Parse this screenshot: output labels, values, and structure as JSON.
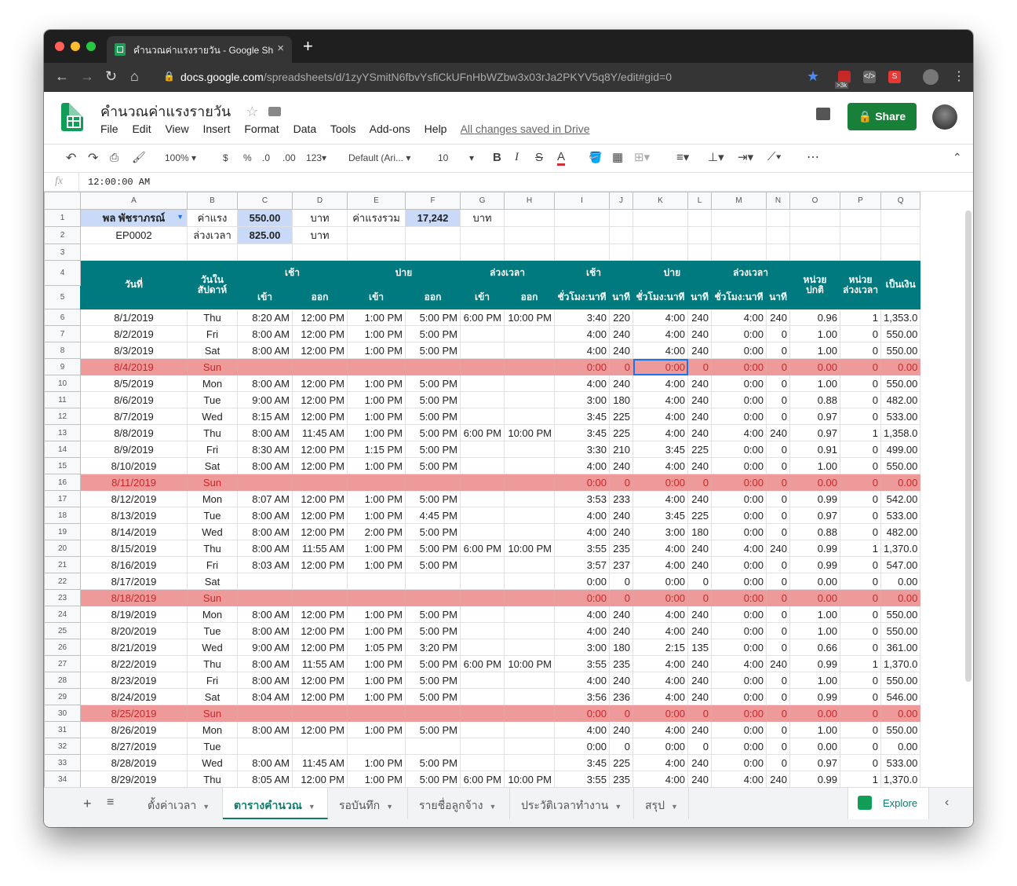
{
  "browser": {
    "tab_title": "คำนวณค่าแรงรายวัน - Google Sh",
    "url_domain": "docs.google.com",
    "url_path": "/spreadsheets/d/1zyYSmitN6fbvYsfiCkUFnHbWZbw3x03rJa2PKYV5q8Y/edit#gid=0",
    "ext_badge": ">3k"
  },
  "doc": {
    "title": "คำนวณค่าแรงรายวัน",
    "menus": [
      "File",
      "Edit",
      "View",
      "Insert",
      "Format",
      "Data",
      "Tools",
      "Add-ons",
      "Help"
    ],
    "saved_status": "All changes saved in Drive",
    "share_label": "Share"
  },
  "toolbar": {
    "zoom": "100%",
    "currency": "$",
    "percent": "%",
    "dec_less": ".0",
    "dec_more": ".00",
    "format_more": "123",
    "font": "Default (Ari...",
    "font_size": "10",
    "bold": "B",
    "italic": "I",
    "strike": "S",
    "text_color": "A",
    "more": "⋯"
  },
  "formula_bar": {
    "fx": "fx",
    "value": "12:00:00 AM"
  },
  "columns": [
    "A",
    "B",
    "C",
    "D",
    "E",
    "F",
    "G",
    "H",
    "I",
    "J",
    "K",
    "L",
    "M",
    "N",
    "O",
    "P",
    "Q"
  ],
  "top_rows": [
    [
      "พล พัชราภรณ์",
      "ค่าแรง",
      "550.00",
      "บาท",
      "ค่าแรงรวม",
      "17,242",
      "บาท",
      "",
      "",
      "",
      "",
      "",
      "",
      "",
      "",
      "",
      ""
    ],
    [
      "EP0002",
      "ล่วงเวลา",
      "825.00",
      "บาท",
      "",
      "",
      "",
      "",
      "",
      "",
      "",
      "",
      "",
      "",
      "",
      "",
      ""
    ],
    [
      "",
      "",
      "",
      "",
      "",
      "",
      "",
      "",
      "",
      "",
      "",
      "",
      "",
      "",
      "",
      "",
      ""
    ]
  ],
  "header": {
    "date": "วันที่",
    "weekday": "วันใน\nสัปดาห์",
    "morning": "เช้า",
    "afternoon": "บ่าย",
    "overtime": "ล่วงเวลา",
    "in": "เข้า",
    "out": "ออก",
    "hm": "ชั่วโมง:นาที",
    "min": "นาที",
    "units_normal": "หน่วย\nปกติ",
    "units_ot": "หน่วย\nล่วงเวลา",
    "amount": "เป็นเงิน"
  },
  "rows": [
    {
      "n": "6",
      "sun": false,
      "v": [
        "8/1/2019",
        "Thu",
        "8:20 AM",
        "12:00 PM",
        "1:00 PM",
        "5:00 PM",
        "6:00 PM",
        "10:00 PM",
        "3:40",
        "220",
        "4:00",
        "240",
        "4:00",
        "240",
        "0.96",
        "1",
        "1,353.0"
      ]
    },
    {
      "n": "7",
      "sun": false,
      "v": [
        "8/2/2019",
        "Fri",
        "8:00 AM",
        "12:00 PM",
        "1:00 PM",
        "5:00 PM",
        "",
        "",
        "4:00",
        "240",
        "4:00",
        "240",
        "0:00",
        "0",
        "1.00",
        "0",
        "550.00"
      ]
    },
    {
      "n": "8",
      "sun": false,
      "v": [
        "8/3/2019",
        "Sat",
        "8:00 AM",
        "12:00 PM",
        "1:00 PM",
        "5:00 PM",
        "",
        "",
        "4:00",
        "240",
        "4:00",
        "240",
        "0:00",
        "0",
        "1.00",
        "0",
        "550.00"
      ]
    },
    {
      "n": "9",
      "sun": true,
      "v": [
        "8/4/2019",
        "Sun",
        "",
        "",
        "",
        "",
        "",
        "",
        "0:00",
        "0",
        "0:00",
        "0",
        "0:00",
        "0",
        "0.00",
        "0",
        "0.00"
      ]
    },
    {
      "n": "10",
      "sun": false,
      "v": [
        "8/5/2019",
        "Mon",
        "8:00 AM",
        "12:00 PM",
        "1:00 PM",
        "5:00 PM",
        "",
        "",
        "4:00",
        "240",
        "4:00",
        "240",
        "0:00",
        "0",
        "1.00",
        "0",
        "550.00"
      ]
    },
    {
      "n": "11",
      "sun": false,
      "v": [
        "8/6/2019",
        "Tue",
        "9:00 AM",
        "12:00 PM",
        "1:00 PM",
        "5:00 PM",
        "",
        "",
        "3:00",
        "180",
        "4:00",
        "240",
        "0:00",
        "0",
        "0.88",
        "0",
        "482.00"
      ]
    },
    {
      "n": "12",
      "sun": false,
      "v": [
        "8/7/2019",
        "Wed",
        "8:15 AM",
        "12:00 PM",
        "1:00 PM",
        "5:00 PM",
        "",
        "",
        "3:45",
        "225",
        "4:00",
        "240",
        "0:00",
        "0",
        "0.97",
        "0",
        "533.00"
      ]
    },
    {
      "n": "13",
      "sun": false,
      "v": [
        "8/8/2019",
        "Thu",
        "8:00 AM",
        "11:45 AM",
        "1:00 PM",
        "5:00 PM",
        "6:00 PM",
        "10:00 PM",
        "3:45",
        "225",
        "4:00",
        "240",
        "4:00",
        "240",
        "0.97",
        "1",
        "1,358.0"
      ]
    },
    {
      "n": "14",
      "sun": false,
      "v": [
        "8/9/2019",
        "Fri",
        "8:30 AM",
        "12:00 PM",
        "1:15 PM",
        "5:00 PM",
        "",
        "",
        "3:30",
        "210",
        "3:45",
        "225",
        "0:00",
        "0",
        "0.91",
        "0",
        "499.00"
      ]
    },
    {
      "n": "15",
      "sun": false,
      "v": [
        "8/10/2019",
        "Sat",
        "8:00 AM",
        "12:00 PM",
        "1:00 PM",
        "5:00 PM",
        "",
        "",
        "4:00",
        "240",
        "4:00",
        "240",
        "0:00",
        "0",
        "1.00",
        "0",
        "550.00"
      ]
    },
    {
      "n": "16",
      "sun": true,
      "v": [
        "8/11/2019",
        "Sun",
        "",
        "",
        "",
        "",
        "",
        "",
        "0:00",
        "0",
        "0:00",
        "0",
        "0:00",
        "0",
        "0.00",
        "0",
        "0.00"
      ]
    },
    {
      "n": "17",
      "sun": false,
      "v": [
        "8/12/2019",
        "Mon",
        "8:07 AM",
        "12:00 PM",
        "1:00 PM",
        "5:00 PM",
        "",
        "",
        "3:53",
        "233",
        "4:00",
        "240",
        "0:00",
        "0",
        "0.99",
        "0",
        "542.00"
      ]
    },
    {
      "n": "18",
      "sun": false,
      "v": [
        "8/13/2019",
        "Tue",
        "8:00 AM",
        "12:00 PM",
        "1:00 PM",
        "4:45 PM",
        "",
        "",
        "4:00",
        "240",
        "3:45",
        "225",
        "0:00",
        "0",
        "0.97",
        "0",
        "533.00"
      ]
    },
    {
      "n": "19",
      "sun": false,
      "v": [
        "8/14/2019",
        "Wed",
        "8:00 AM",
        "12:00 PM",
        "2:00 PM",
        "5:00 PM",
        "",
        "",
        "4:00",
        "240",
        "3:00",
        "180",
        "0:00",
        "0",
        "0.88",
        "0",
        "482.00"
      ]
    },
    {
      "n": "20",
      "sun": false,
      "v": [
        "8/15/2019",
        "Thu",
        "8:00 AM",
        "11:55 AM",
        "1:00 PM",
        "5:00 PM",
        "6:00 PM",
        "10:00 PM",
        "3:55",
        "235",
        "4:00",
        "240",
        "4:00",
        "240",
        "0.99",
        "1",
        "1,370.0"
      ]
    },
    {
      "n": "21",
      "sun": false,
      "v": [
        "8/16/2019",
        "Fri",
        "8:03 AM",
        "12:00 PM",
        "1:00 PM",
        "5:00 PM",
        "",
        "",
        "3:57",
        "237",
        "4:00",
        "240",
        "0:00",
        "0",
        "0.99",
        "0",
        "547.00"
      ]
    },
    {
      "n": "22",
      "sun": false,
      "v": [
        "8/17/2019",
        "Sat",
        "",
        "",
        "",
        "",
        "",
        "",
        "0:00",
        "0",
        "0:00",
        "0",
        "0:00",
        "0",
        "0.00",
        "0",
        "0.00"
      ]
    },
    {
      "n": "23",
      "sun": true,
      "v": [
        "8/18/2019",
        "Sun",
        "",
        "",
        "",
        "",
        "",
        "",
        "0:00",
        "0",
        "0:00",
        "0",
        "0:00",
        "0",
        "0.00",
        "0",
        "0.00"
      ]
    },
    {
      "n": "24",
      "sun": false,
      "v": [
        "8/19/2019",
        "Mon",
        "8:00 AM",
        "12:00 PM",
        "1:00 PM",
        "5:00 PM",
        "",
        "",
        "4:00",
        "240",
        "4:00",
        "240",
        "0:00",
        "0",
        "1.00",
        "0",
        "550.00"
      ]
    },
    {
      "n": "25",
      "sun": false,
      "v": [
        "8/20/2019",
        "Tue",
        "8:00 AM",
        "12:00 PM",
        "1:00 PM",
        "5:00 PM",
        "",
        "",
        "4:00",
        "240",
        "4:00",
        "240",
        "0:00",
        "0",
        "1.00",
        "0",
        "550.00"
      ]
    },
    {
      "n": "26",
      "sun": false,
      "v": [
        "8/21/2019",
        "Wed",
        "9:00 AM",
        "12:00 PM",
        "1:05 PM",
        "3:20 PM",
        "",
        "",
        "3:00",
        "180",
        "2:15",
        "135",
        "0:00",
        "0",
        "0.66",
        "0",
        "361.00"
      ]
    },
    {
      "n": "27",
      "sun": false,
      "v": [
        "8/22/2019",
        "Thu",
        "8:00 AM",
        "11:55 AM",
        "1:00 PM",
        "5:00 PM",
        "6:00 PM",
        "10:00 PM",
        "3:55",
        "235",
        "4:00",
        "240",
        "4:00",
        "240",
        "0.99",
        "1",
        "1,370.0"
      ]
    },
    {
      "n": "28",
      "sun": false,
      "v": [
        "8/23/2019",
        "Fri",
        "8:00 AM",
        "12:00 PM",
        "1:00 PM",
        "5:00 PM",
        "",
        "",
        "4:00",
        "240",
        "4:00",
        "240",
        "0:00",
        "0",
        "1.00",
        "0",
        "550.00"
      ]
    },
    {
      "n": "29",
      "sun": false,
      "v": [
        "8/24/2019",
        "Sat",
        "8:04 AM",
        "12:00 PM",
        "1:00 PM",
        "5:00 PM",
        "",
        "",
        "3:56",
        "236",
        "4:00",
        "240",
        "0:00",
        "0",
        "0.99",
        "0",
        "546.00"
      ]
    },
    {
      "n": "30",
      "sun": true,
      "v": [
        "8/25/2019",
        "Sun",
        "",
        "",
        "",
        "",
        "",
        "",
        "0:00",
        "0",
        "0:00",
        "0",
        "0:00",
        "0",
        "0.00",
        "0",
        "0.00"
      ]
    },
    {
      "n": "31",
      "sun": false,
      "v": [
        "8/26/2019",
        "Mon",
        "8:00 AM",
        "12:00 PM",
        "1:00 PM",
        "5:00 PM",
        "",
        "",
        "4:00",
        "240",
        "4:00",
        "240",
        "0:00",
        "0",
        "1.00",
        "0",
        "550.00"
      ]
    },
    {
      "n": "32",
      "sun": false,
      "v": [
        "8/27/2019",
        "Tue",
        "",
        "",
        "",
        "",
        "",
        "",
        "0:00",
        "0",
        "0:00",
        "0",
        "0:00",
        "0",
        "0.00",
        "0",
        "0.00"
      ]
    },
    {
      "n": "33",
      "sun": false,
      "v": [
        "8/28/2019",
        "Wed",
        "8:00 AM",
        "11:45 AM",
        "1:00 PM",
        "5:00 PM",
        "",
        "",
        "3:45",
        "225",
        "4:00",
        "240",
        "0:00",
        "0",
        "0.97",
        "0",
        "533.00"
      ]
    },
    {
      "n": "34",
      "sun": false,
      "v": [
        "8/29/2019",
        "Thu",
        "8:05 AM",
        "12:00 PM",
        "1:00 PM",
        "5:00 PM",
        "6:00 PM",
        "10:00 PM",
        "3:55",
        "235",
        "4:00",
        "240",
        "4:00",
        "240",
        "0.99",
        "1",
        "1,370.0"
      ]
    }
  ],
  "sheet_tabs": [
    "ตั้งค่าเวลา",
    "ตารางคำนวณ",
    "รอบันทึก",
    "รายชื่อลูกจ้าง",
    "ประวัติเวลาทำงาน",
    "สรุป"
  ],
  "active_tab": "ตารางคำนวณ",
  "explore_label": "Explore",
  "colors": {
    "header_teal": "#00797f",
    "sunday_fill": "#ef9a9a",
    "sunday_text": "#c62828",
    "share_green": "#188038",
    "highlight_blue": "#c9daf8"
  }
}
